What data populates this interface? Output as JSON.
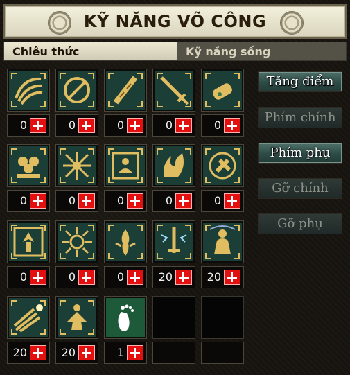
{
  "header": {
    "title": "KỸ NĂNG VÕ CÔNG"
  },
  "tabs": [
    {
      "label": "Chiêu thức",
      "active": true
    },
    {
      "label": "Kỹ năng sống",
      "active": false
    }
  ],
  "side_buttons": [
    {
      "label": "Tăng điểm",
      "enabled": true
    },
    {
      "label": "Phím chính",
      "enabled": false
    },
    {
      "label": "Phím phụ",
      "enabled": true
    },
    {
      "label": "Gỡ chính",
      "enabled": false
    },
    {
      "label": "Gỡ phụ",
      "enabled": false
    }
  ],
  "skills": [
    {
      "icon": "wind-wing-icon",
      "count": "0"
    },
    {
      "icon": "slash-circle-icon",
      "count": "0"
    },
    {
      "icon": "staff-icon",
      "count": "0"
    },
    {
      "icon": "sword-icon",
      "count": "0"
    },
    {
      "icon": "gauntlet-icon",
      "count": "0"
    },
    {
      "icon": "cloud-orbs-icon",
      "count": "0"
    },
    {
      "icon": "spike-burst-icon",
      "count": "0"
    },
    {
      "icon": "meditation-icon",
      "count": "0"
    },
    {
      "icon": "flame-wave-icon",
      "count": "0"
    },
    {
      "icon": "cross-shield-icon",
      "count": "0"
    },
    {
      "icon": "fist-tree-icon",
      "count": "0"
    },
    {
      "icon": "sun-burst-icon",
      "count": "0"
    },
    {
      "icon": "scorpion-icon",
      "count": "0"
    },
    {
      "icon": "lightning-sword-icon",
      "count": "20"
    },
    {
      "icon": "warrior-icon",
      "count": "20"
    },
    {
      "icon": "comet-icon",
      "count": "20"
    },
    {
      "icon": "golden-figure-icon",
      "count": "20"
    },
    {
      "icon": "footprint-icon",
      "count": "1"
    }
  ],
  "colors": {
    "gold": "#d9b55a",
    "plus_red": "#e41010",
    "teal_bg": "#1f4a40"
  }
}
